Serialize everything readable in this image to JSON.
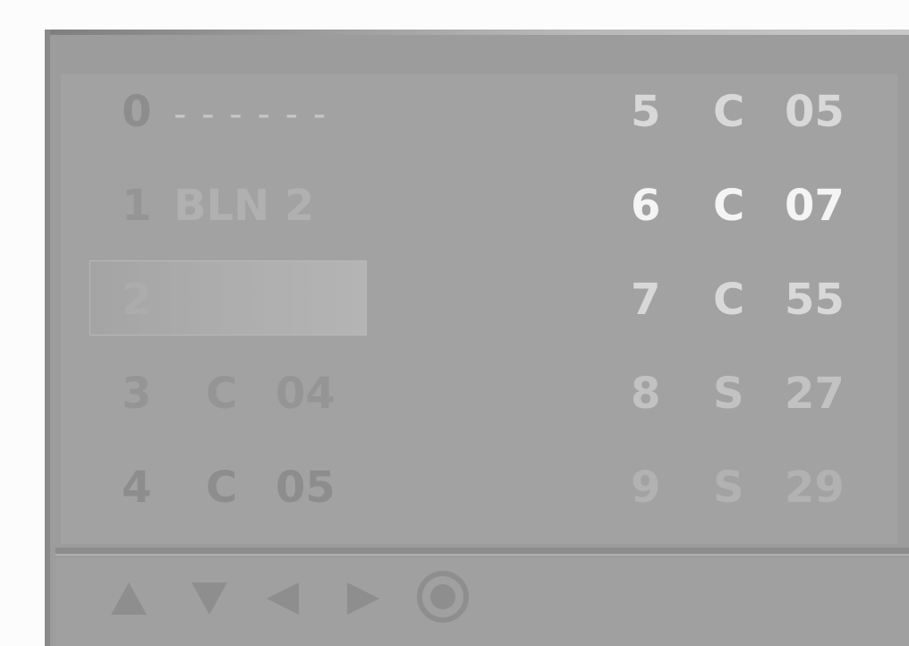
{
  "program_list": {
    "left_column": [
      {
        "number": "0",
        "type": "",
        "name": "- - - - - -"
      },
      {
        "number": "1",
        "type": "",
        "name": "BLN 2"
      },
      {
        "number": "2",
        "type": "",
        "name": ""
      },
      {
        "number": "3",
        "type": "C",
        "name": "04"
      },
      {
        "number": "4",
        "type": "C",
        "name": "05"
      }
    ],
    "right_column": [
      {
        "number": "5",
        "type": "C",
        "name": "05"
      },
      {
        "number": "6",
        "type": "C",
        "name": "07"
      },
      {
        "number": "7",
        "type": "C",
        "name": "55"
      },
      {
        "number": "8",
        "type": "S",
        "name": "27"
      },
      {
        "number": "9",
        "type": "S",
        "name": "29"
      }
    ],
    "selected_index": 2
  },
  "footer": {
    "icons": [
      "up-arrow-icon",
      "down-arrow-icon",
      "left-arrow-icon",
      "right-arrow-icon",
      "ok-button-icon"
    ]
  },
  "colors": {
    "panel": "#9c9c9c",
    "highlight": "#b0b0b0",
    "text_white": "#f4f4f4"
  }
}
